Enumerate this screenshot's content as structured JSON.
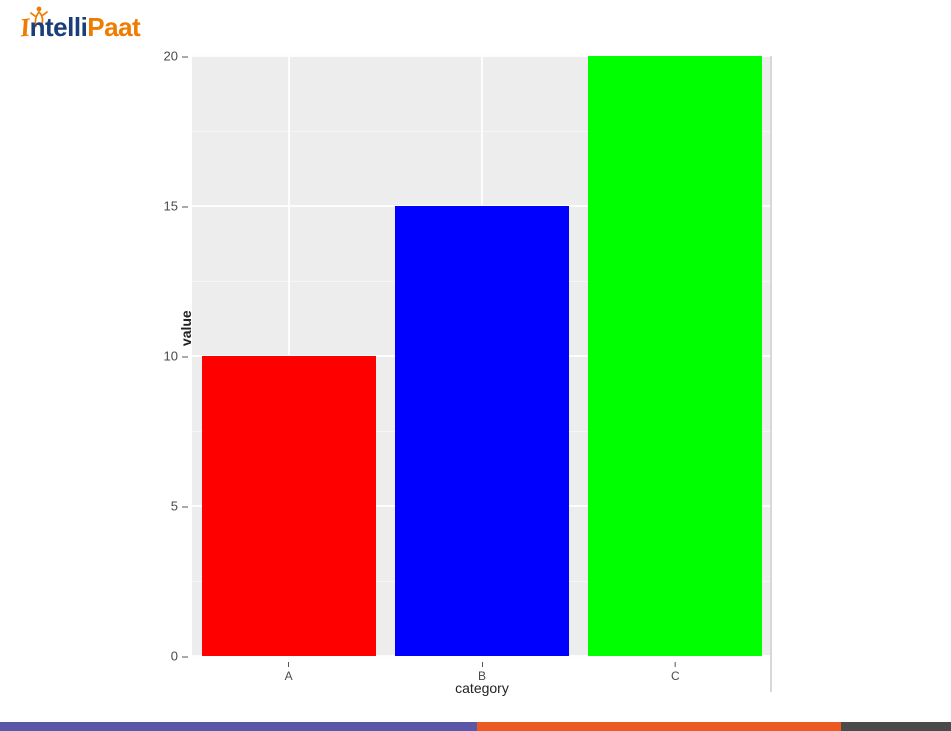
{
  "logo": {
    "part1": "ntelli",
    "part2": "Paat"
  },
  "chart_data": {
    "type": "bar",
    "categories": [
      "A",
      "B",
      "C"
    ],
    "values": [
      10,
      15,
      20
    ],
    "colors": [
      "#ff0000",
      "#0000ff",
      "#00ff00"
    ],
    "xlabel": "category",
    "ylabel": "value",
    "ylim": [
      0,
      20
    ],
    "y_ticks": [
      0,
      5,
      10,
      15,
      20
    ]
  }
}
